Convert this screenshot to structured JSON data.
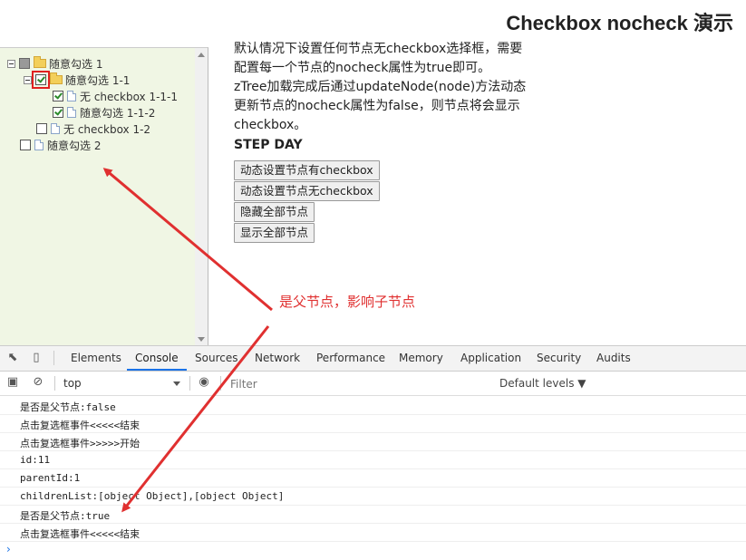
{
  "page": {
    "title": "Checkbox nocheck 演示"
  },
  "tree": {
    "nodes": [
      {
        "label": "随意勾选 1"
      },
      {
        "label": "随意勾选 1-1"
      },
      {
        "label": "无 checkbox 1-1-1"
      },
      {
        "label": "随意勾选 1-1-2"
      },
      {
        "label": "无 checkbox 1-2"
      },
      {
        "label": "随意勾选 2"
      }
    ]
  },
  "description": {
    "lines": [
      "默认情况下设置任何节点无checkbox选择框，需要",
      "配置每一个节点的nocheck属性为true即可。",
      "zTree加载完成后通过updateNode(node)方法动态",
      "更新节点的nocheck属性为false，则节点将会显示",
      "checkbox。"
    ],
    "step": "STEP DAY"
  },
  "buttons": {
    "set_has": "动态设置节点有checkbox",
    "set_no": "动态设置节点无checkbox",
    "hide_all": "隐藏全部节点",
    "show_all": "显示全部节点"
  },
  "annotation": {
    "text": "是父节点，影响子节点",
    "color": "#e03030"
  },
  "devtools": {
    "tabs": [
      "Elements",
      "Console",
      "Sources",
      "Network",
      "Performance",
      "Memory",
      "Application",
      "Security",
      "Audits"
    ],
    "active_tab": "Console",
    "context": "top",
    "filter_placeholder": "Filter",
    "levels": "Default levels ▼",
    "logs": [
      "是否是父节点:false",
      "点击复选框事件<<<<<结束",
      "点击复选框事件>>>>>开始",
      "id:11",
      "parentId:1",
      "childrenList:[object Object],[object Object]",
      "是否是父节点:true",
      "点击复选框事件<<<<<结束"
    ],
    "prompt": "›"
  }
}
